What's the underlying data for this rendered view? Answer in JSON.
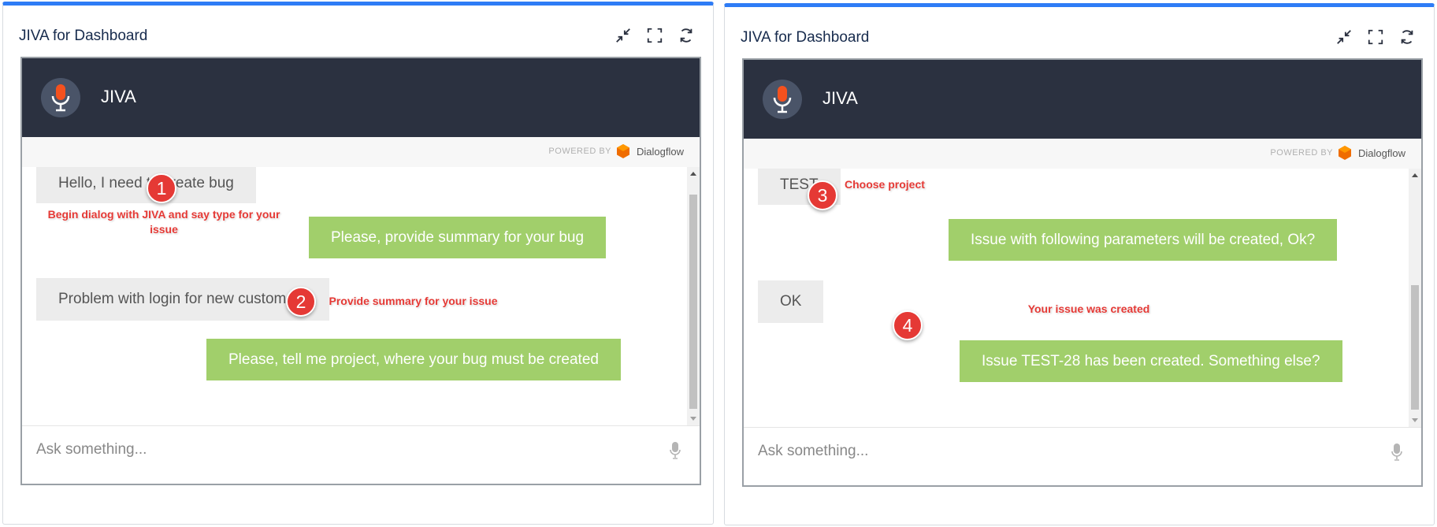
{
  "panels": [
    {
      "title": "JIVA for Dashboard",
      "bot_name": "JIVA",
      "powered_by": "POWERED BY",
      "provider": "Dialogflow",
      "input_placeholder": "Ask something...",
      "messages": [
        {
          "role": "user",
          "text": "Hello, I need to create bug"
        },
        {
          "role": "bot",
          "text": "Please, provide summary for your bug"
        },
        {
          "role": "user",
          "text": "Problem with login for new customers"
        },
        {
          "role": "bot",
          "text": "Please, tell me project, where your bug must be created"
        }
      ],
      "annotations": [
        {
          "number": "1",
          "text": "Begin dialog with JIVA and say type for your issue"
        },
        {
          "number": "2",
          "text": "Provide summary for your issue"
        }
      ]
    },
    {
      "title": "JIVA for Dashboard",
      "bot_name": "JIVA",
      "powered_by": "POWERED BY",
      "provider": "Dialogflow",
      "input_placeholder": "Ask something...",
      "messages": [
        {
          "role": "user",
          "text": "TEST"
        },
        {
          "role": "bot",
          "text": "Issue with following parameters will be created, Ok?"
        },
        {
          "role": "user",
          "text": "OK"
        },
        {
          "role": "bot",
          "text": "Issue TEST-28 has been created. Something else?"
        }
      ],
      "annotations": [
        {
          "number": "3",
          "text": "Choose project"
        },
        {
          "number": "4",
          "text": "Your issue was created"
        }
      ]
    }
  ],
  "colors": {
    "accent": "#2e7cf6",
    "header": "#2b3140",
    "user_bubble": "#ececec",
    "bot_bubble": "#a1cf6b",
    "annotation": "#e53935",
    "mic": "#f4511e"
  },
  "icons": {
    "tools": [
      "collapse-icon",
      "fullscreen-icon",
      "refresh-icon"
    ],
    "avatar": "microphone-icon",
    "input": "microphone-icon",
    "provider_logo": "dialogflow-logo-icon"
  }
}
